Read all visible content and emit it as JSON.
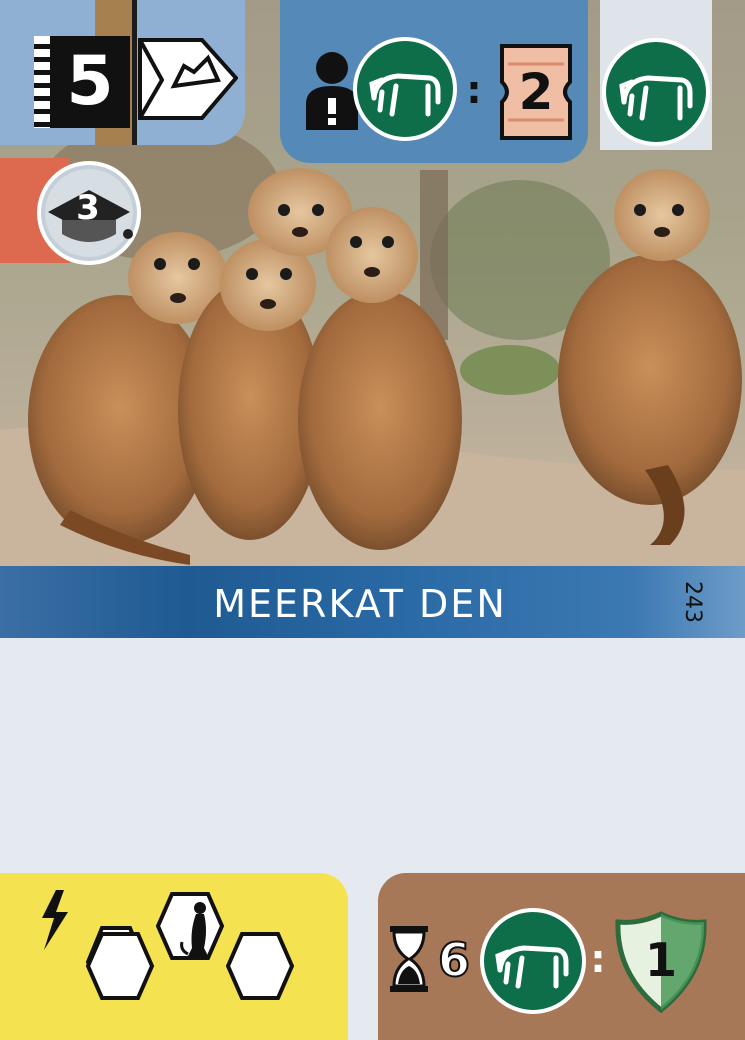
{
  "card": {
    "name": "MEERKAT DEN",
    "number": "243"
  },
  "top_left": {
    "cost": "5",
    "icons": [
      "film-strip-icon",
      "flag-rock-icon"
    ]
  },
  "badge": {
    "value": "3",
    "icon": "graduation-cap-icon"
  },
  "condition": {
    "left_icons": [
      "person-alert-icon",
      "grazing-animal-icon"
    ],
    "separator": ":",
    "ticket_value": "2"
  },
  "top_right": {
    "icon": "grazing-animal-icon"
  },
  "bottom_left": {
    "icons": [
      "lightning-icon",
      "hex-enclosure-icon",
      "meerkat-icon"
    ]
  },
  "bottom_right": {
    "time_value": "6",
    "separator": ":",
    "shield_value": "1",
    "icons": [
      "hourglass-icon",
      "grazing-animal-icon",
      "shield-icon"
    ]
  },
  "colors": {
    "top_left_panel": "#8fb0d3",
    "top_panel": "#5589b8",
    "name_band": "#1f5a92",
    "red_band": "#dd6a4f",
    "yellow_panel": "#f4e250",
    "brown_panel": "#a77858",
    "green_badge": "#0f6e4a"
  }
}
